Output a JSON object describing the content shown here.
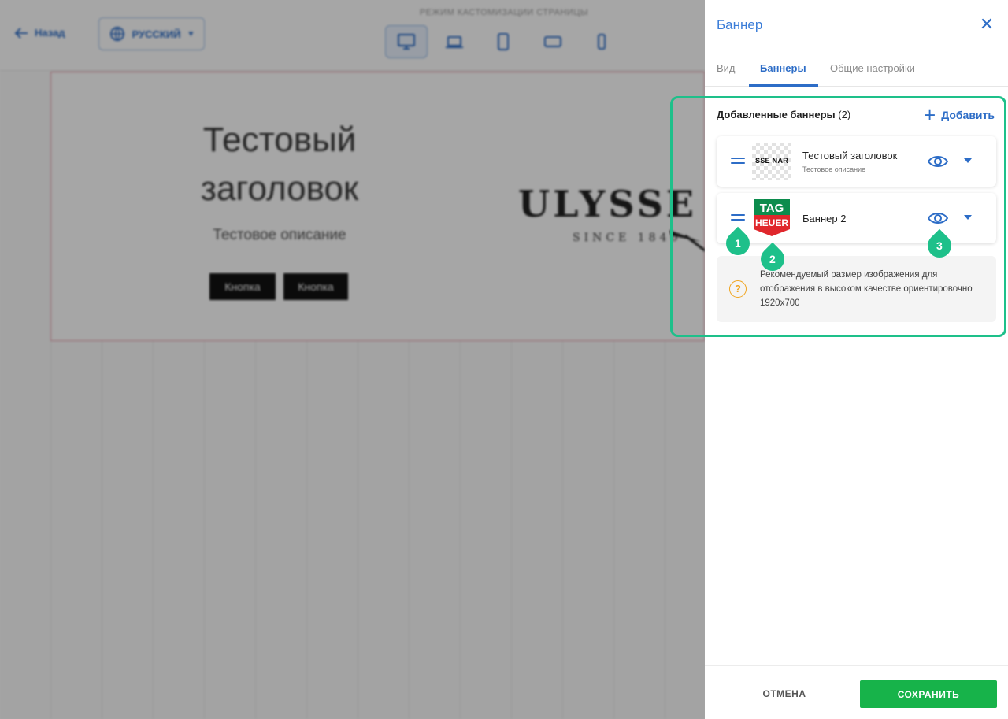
{
  "editor": {
    "back_label": "Назад",
    "language": "РУССКИЙ",
    "mode_caption": "РЕЖИМ КАСТОМИЗАЦИИ СТРАНИЦЫ",
    "devices": [
      {
        "icon": "desktop-icon",
        "active": true
      },
      {
        "icon": "laptop-icon",
        "active": false
      },
      {
        "icon": "tablet-icon",
        "active": false
      },
      {
        "icon": "tablet-landscape-icon",
        "active": false
      },
      {
        "icon": "mobile-icon",
        "active": false
      }
    ],
    "preview": {
      "title": "Тестовый заголовок",
      "description": "Тестовое описание",
      "button1": "Кнопка",
      "button2": "Кнопка",
      "logo_text": "ULYSSE",
      "logo_since": "SINCE 1846"
    }
  },
  "panel": {
    "title": "Баннер",
    "tabs": [
      {
        "label": "Вид",
        "active": false
      },
      {
        "label": "Баннеры",
        "active": true
      },
      {
        "label": "Общие настройки",
        "active": false
      }
    ],
    "section_title": "Добавленные баннеры",
    "section_count": "(2)",
    "add_label": "Добавить",
    "banners": [
      {
        "title": "Тестовый заголовок",
        "subtitle": "Тестовое описание",
        "thumb_text": "SSE NAR"
      },
      {
        "title": "Баннер 2",
        "subtitle": "",
        "thumb_text_top": "TAG",
        "thumb_text_bottom": "HEUER"
      }
    ],
    "tip": "Рекомендуемый размер изображения для отображения в высоком качестве ориентировочно 1920x700",
    "cancel_label": "ОТМЕНА",
    "save_label": "СОХРАНИТЬ"
  },
  "markers": [
    "1",
    "2",
    "3"
  ],
  "colors": {
    "accent": "#2d6dc7",
    "highlight": "#1ec08a",
    "save": "#17b34a",
    "tip_icon": "#f0a521"
  }
}
